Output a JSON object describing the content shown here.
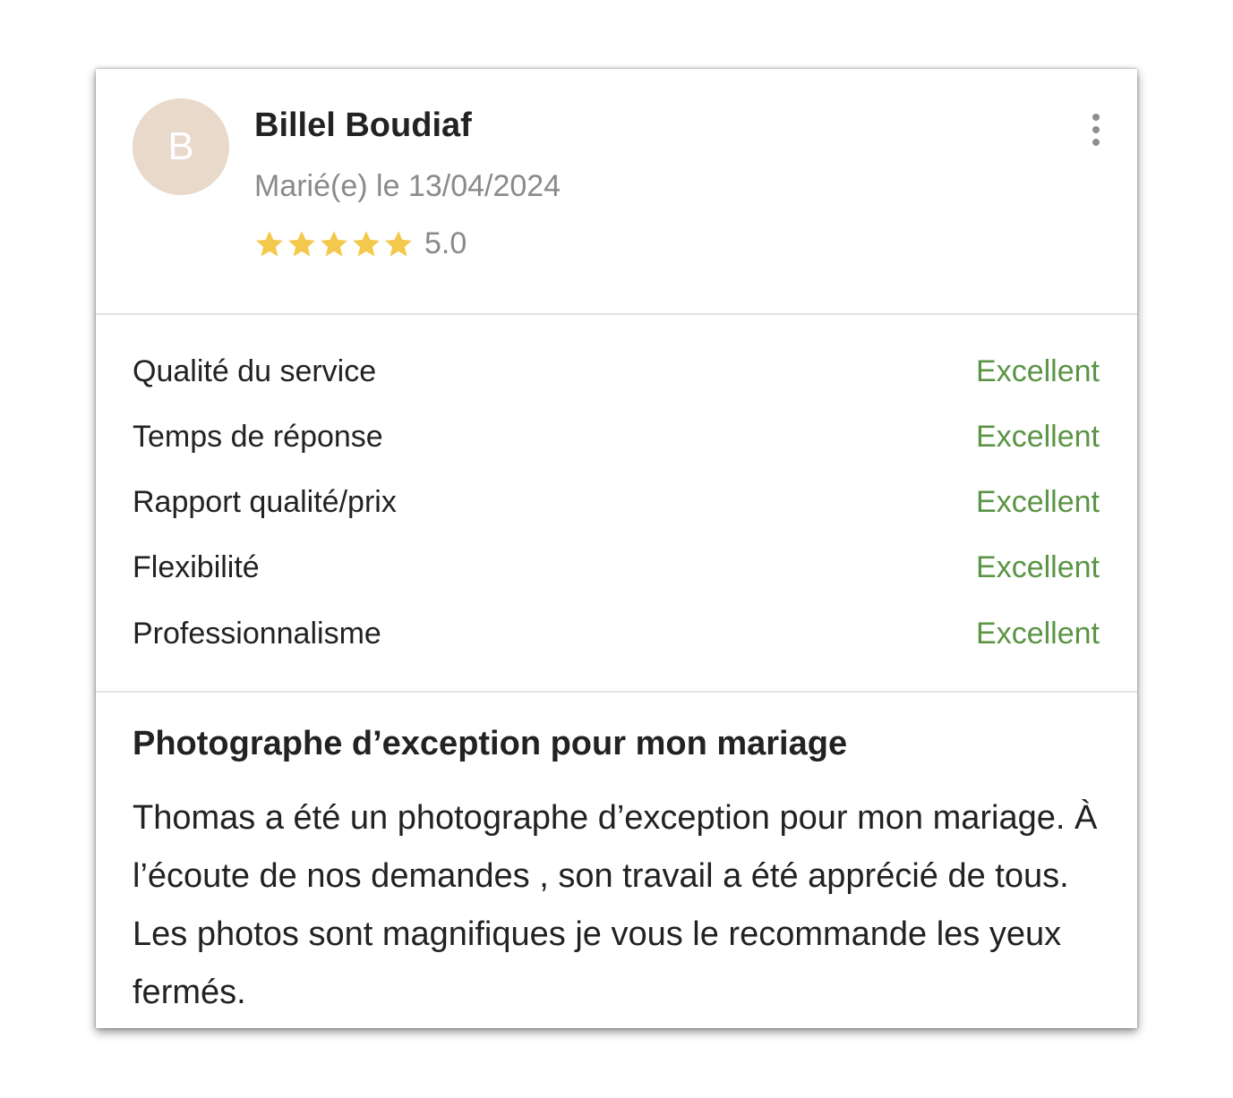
{
  "reviewer": {
    "initial": "B",
    "name": "Billel Boudiaf",
    "date": "Marié(e) le 13/04/2024",
    "rating": 5.0,
    "rating_text": "5.0",
    "stars_filled": 5,
    "stars_total": 5
  },
  "colors": {
    "avatar_bg": "#e8d9cb",
    "star": "#f2c94c",
    "excellent": "#5a9444"
  },
  "icons": {
    "menu": "more-vertical-icon",
    "star": "star-icon"
  },
  "criteria": [
    {
      "label": "Qualité du service",
      "value": "Excellent"
    },
    {
      "label": "Temps de réponse",
      "value": "Excellent"
    },
    {
      "label": "Rapport qualité/prix",
      "value": "Excellent"
    },
    {
      "label": "Flexibilité",
      "value": "Excellent"
    },
    {
      "label": "Professionnalisme",
      "value": "Excellent"
    }
  ],
  "review": {
    "title": "Photographe d’exception pour mon mariage",
    "body": "Thomas a été un photographe d’exception pour mon mariage. À l’écoute de nos demandes , son travail a été apprécié de tous. Les photos sont magnifiques je vous le recommande les yeux fermés."
  }
}
